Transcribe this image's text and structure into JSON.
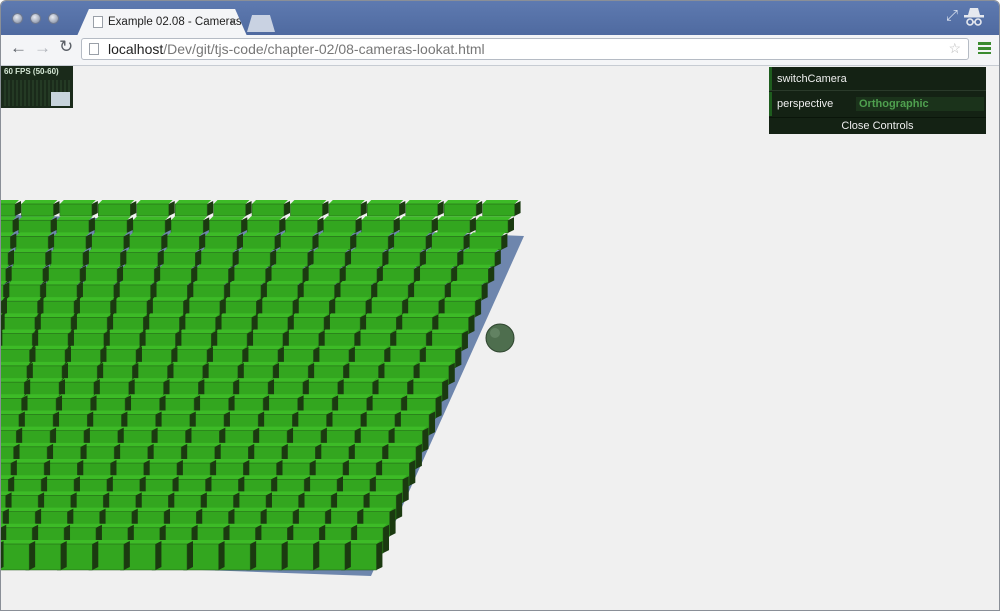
{
  "browser": {
    "tab_title": "Example 02.08 - Cameras",
    "tab_close_glyph": "×",
    "url_host": "localhost",
    "url_path": "/Dev/git/tjs-code/chapter-02/08-cameras-lookat.html",
    "icons": [
      "page-icon",
      "close-icon",
      "new-tab-icon",
      "fullscreen-icon",
      "incognito-icon",
      "back-icon",
      "forward-icon",
      "reload-icon",
      "star-icon",
      "menu-icon"
    ]
  },
  "stats": {
    "fps_text": "60 FPS (50-60)"
  },
  "controls": {
    "switch_camera_label": "switchCamera",
    "perspective_label": "perspective",
    "perspective_value": "Orthographic",
    "close_label": "Close Controls"
  },
  "scene": {
    "ground_color": "#6e86ad",
    "cube_color": "#33a61f",
    "sphere_color": "#4e6e4e",
    "background_color": "#f0f0f0"
  }
}
